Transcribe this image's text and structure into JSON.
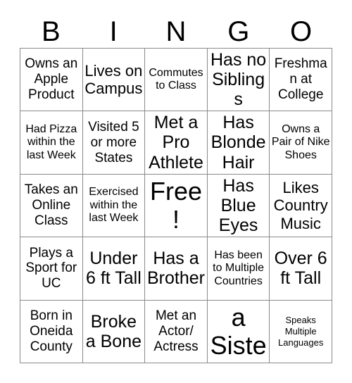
{
  "card": {
    "header_letters": [
      "B",
      "I",
      "N",
      "G",
      "O"
    ],
    "columns": 5,
    "rows": 5,
    "border_color": "#8a8a8a",
    "text_color": "#000000",
    "background_color": "#ffffff",
    "free_space_index": 12,
    "cells": [
      {
        "text": "Owns an Apple Product",
        "size": "md"
      },
      {
        "text": "Lives on Campus",
        "size": "lg"
      },
      {
        "text": "Commutes to Class",
        "size": "sm"
      },
      {
        "text": "Has no Siblings",
        "size": "xl"
      },
      {
        "text": "Freshman at College",
        "size": "md"
      },
      {
        "text": "Had Pizza within the last Week",
        "size": "sm"
      },
      {
        "text": "Visited 5 or more States",
        "size": "md"
      },
      {
        "text": "Met a Pro Athlete",
        "size": "xl"
      },
      {
        "text": "Has Blonde Hair",
        "size": "xl"
      },
      {
        "text": "Owns a Pair of Nike Shoes",
        "size": "sm"
      },
      {
        "text": "Takes an Online Class",
        "size": "md"
      },
      {
        "text": "Exercised within the last Week",
        "size": "sm"
      },
      {
        "text": "Free!",
        "size": "xxl"
      },
      {
        "text": "Has Blue Eyes",
        "size": "xl"
      },
      {
        "text": "Likes Country Music",
        "size": "lg"
      },
      {
        "text": "Plays a Sport for UC",
        "size": "md"
      },
      {
        "text": "Under 6 ft Tall",
        "size": "xl"
      },
      {
        "text": "Has a Brother",
        "size": "xl"
      },
      {
        "text": "Has been to Multiple Countries",
        "size": "sm"
      },
      {
        "text": "Over 6 ft Tall",
        "size": "xl"
      },
      {
        "text": "Born in Oneida County",
        "size": "md"
      },
      {
        "text": "Broke a Bone",
        "size": "xl"
      },
      {
        "text": "Met an Actor/ Actress",
        "size": "md"
      },
      {
        "text": "Has a Sister",
        "size": "xxl"
      },
      {
        "text": "Speaks Multiple Languages",
        "size": "xs"
      }
    ]
  }
}
